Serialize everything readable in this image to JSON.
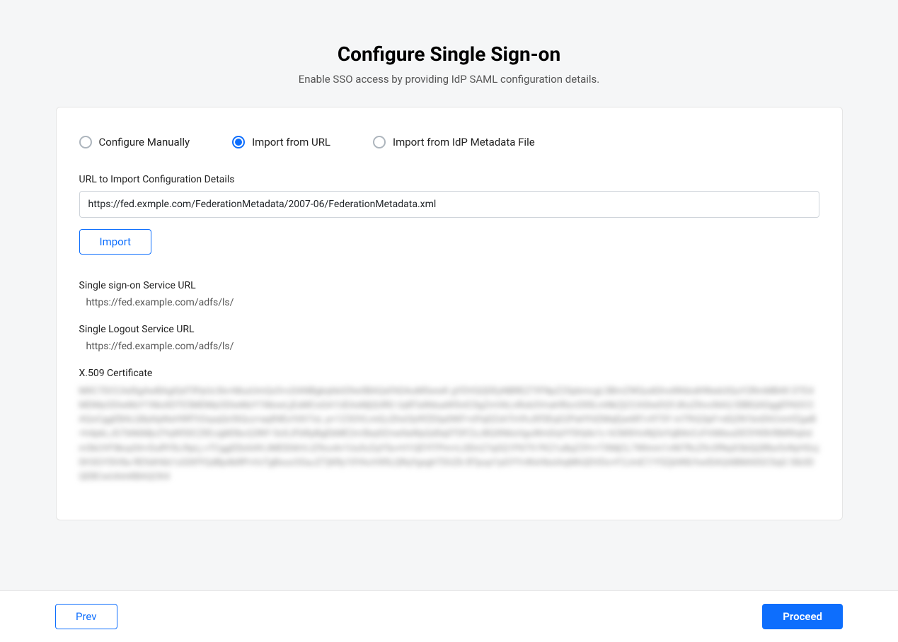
{
  "header": {
    "title": "Configure Single Sign-on",
    "subtitle": "Enable SSO access by providing IdP SAML configuration details."
  },
  "options": {
    "manual": "Configure Manually",
    "url": "Import from URL",
    "file": "Import from IdP Metadata File",
    "selected": "url"
  },
  "url_field": {
    "label": "URL to Import Configuration Details",
    "value": "https://fed.exmple.com/FederationMetadata/2007-06/FederationMetadata.xml"
  },
  "import_button": "Import",
  "sso_url": {
    "label": "Single sign-on Service URL",
    "value": "https://fed.example.com/adfs/ls/"
  },
  "slo_url": {
    "label": "Single Logout Service URL",
    "value": "https://fed.example.com/adfs/ls/"
  },
  "cert": {
    "label": "X.509 Certificate",
    "value_blurred": "MIIC7DCCAdSgAwBAgIQdTlPpUc3lx+MuzUmQx5+cDANBgkqhkiG9w0BAQsFADAuMSwwK gYDVQQDEyNBREZTIFNpZ25pbmcgLSBmZWQudGhvdWdodHNwb3QuY2RmMB4X DTE4MDMyODIwMzY1NloXDTE5MDMyODIwMzY1NlowLjEsMCoGA1UEAxMjQURG UyBTaWduaW5nIC0gZmVkLnRob3VnaHRzcG90LmNkZjCCASIwDQYJKoZIhvcNAQ EBBQADggEPADCCAQoCggEBALQ8y6IpNxH9RTtOsyqQn5tQcz+aqR4ExYdV7oL p+1Z3OVLmiQJ2hxI3y9fZE6p0tKF+dYqDZxhTnVhJ0f3EqG2PaHYd2MqEjw6R1v9T5Y mTfhQ3pF+dQ2N1bnDhCnmfZgaB+h4pkLJG7bN6MjvZYqW5SCZlEtJgM3bcQ3NY 0xXJFbRpBgEkME2m5bq9Zme9aWpQd0q0TDFZzJ8QXN6sVguWmDqVY5Hj4x1c hCMXHviNj3xYqB4nCcFrhMwuDE5YKRrf8M9tqhdm5kUVF8kxy0A+DuRYStJ9pLj vTCggEEkAI4VJMEID6hVJZ9co4v1Uu5vZqY5o+H1QEYITPm+Li3Dn27qGQ1P6T9 FK21u8qZ3Yr+TXMjCL7Wlmm1vNl7RcZ9v3fNqX3bGjQRbx5vNyHGcj0H3GY5lV8a RE9dH6b1zG0tfYQdBp4bRPvVxTgBxucOGaJZTjKRy10YAcHXfiLQRqYgxghTDUZk BTpuyi1pGYYvWxHbxIAqMhQDVDo+F2JmE7/Y5Zj6W8/hwIDAQABMA0GCSqG SIb3DQEBCwUAA4IBAQCK4"
  },
  "footer": {
    "prev": "Prev",
    "proceed": "Proceed"
  }
}
